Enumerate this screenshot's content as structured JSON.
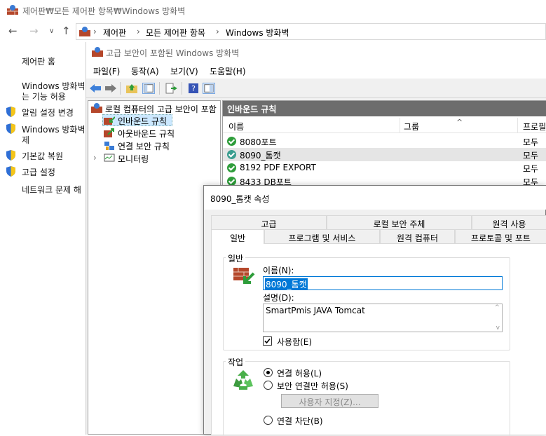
{
  "window": {
    "title": "제어판₩모든 제어판 항목₩Windows 방화벽"
  },
  "address": {
    "crumbs": [
      "제어판",
      "모든 제어판 항목",
      "Windows 방화벽"
    ]
  },
  "left_pane": {
    "home": "제어판 홈",
    "features_line1": "Windows 방화벽",
    "features_line2": "는 기능 허용",
    "notify": "알림 설정 변경",
    "onoff_line1": "Windows 방화벽",
    "onoff_line2": "제",
    "restore": "기본값 복원",
    "advanced": "고급 설정",
    "troubleshoot": "네트워크 문제 해"
  },
  "mmc": {
    "title": "고급 보안이 포함된 Windows 방화벽",
    "menu": [
      "파일(F)",
      "동작(A)",
      "보기(V)",
      "도움말(H)"
    ],
    "tree": {
      "root": "로컬 컴퓨터의 고급 보안이 포함",
      "items": [
        "인바운드 규칙",
        "아웃바운드 규칙",
        "연결 보안 규칙",
        "모니터링"
      ]
    },
    "rules": {
      "header": "인바운드 규칙",
      "columns": [
        "이름",
        "그룹",
        "프로필"
      ],
      "rows": [
        {
          "name": "8080포트",
          "profile": "모두"
        },
        {
          "name": "8090_톰캣",
          "profile": "모두"
        },
        {
          "name": "8192 PDF EXPORT",
          "profile": "모두"
        },
        {
          "name": "8433 DB포트",
          "profile": "모두"
        }
      ]
    }
  },
  "dialog": {
    "title": "8090_톰캣 속성",
    "tabs_row1": [
      "고급",
      "로컬 보안 주체",
      "원격 사용"
    ],
    "tabs_row2": [
      "일반",
      "프로그램 및 서비스",
      "원격 컴퓨터",
      "프로토콜 및 포트"
    ],
    "general": {
      "group_label": "일반",
      "name_label": "이름(N):",
      "name_value": "8090_톰캣",
      "desc_label": "설명(D):",
      "desc_value": "SmartPmis JAVA Tomcat",
      "enabled_label": "사용함(E)",
      "enabled": true
    },
    "action": {
      "group_label": "작업",
      "allow": "연결 허용(L)",
      "secure_only": "보안 연결만 허용(S)",
      "customize": "사용자 지정(Z)...",
      "block": "연결 차단(B)",
      "selected": "allow"
    }
  },
  "colors": {
    "rule_header_bg": "#6d6d6d",
    "selection": "#0078d7",
    "check_green": "#2e9d3a"
  }
}
